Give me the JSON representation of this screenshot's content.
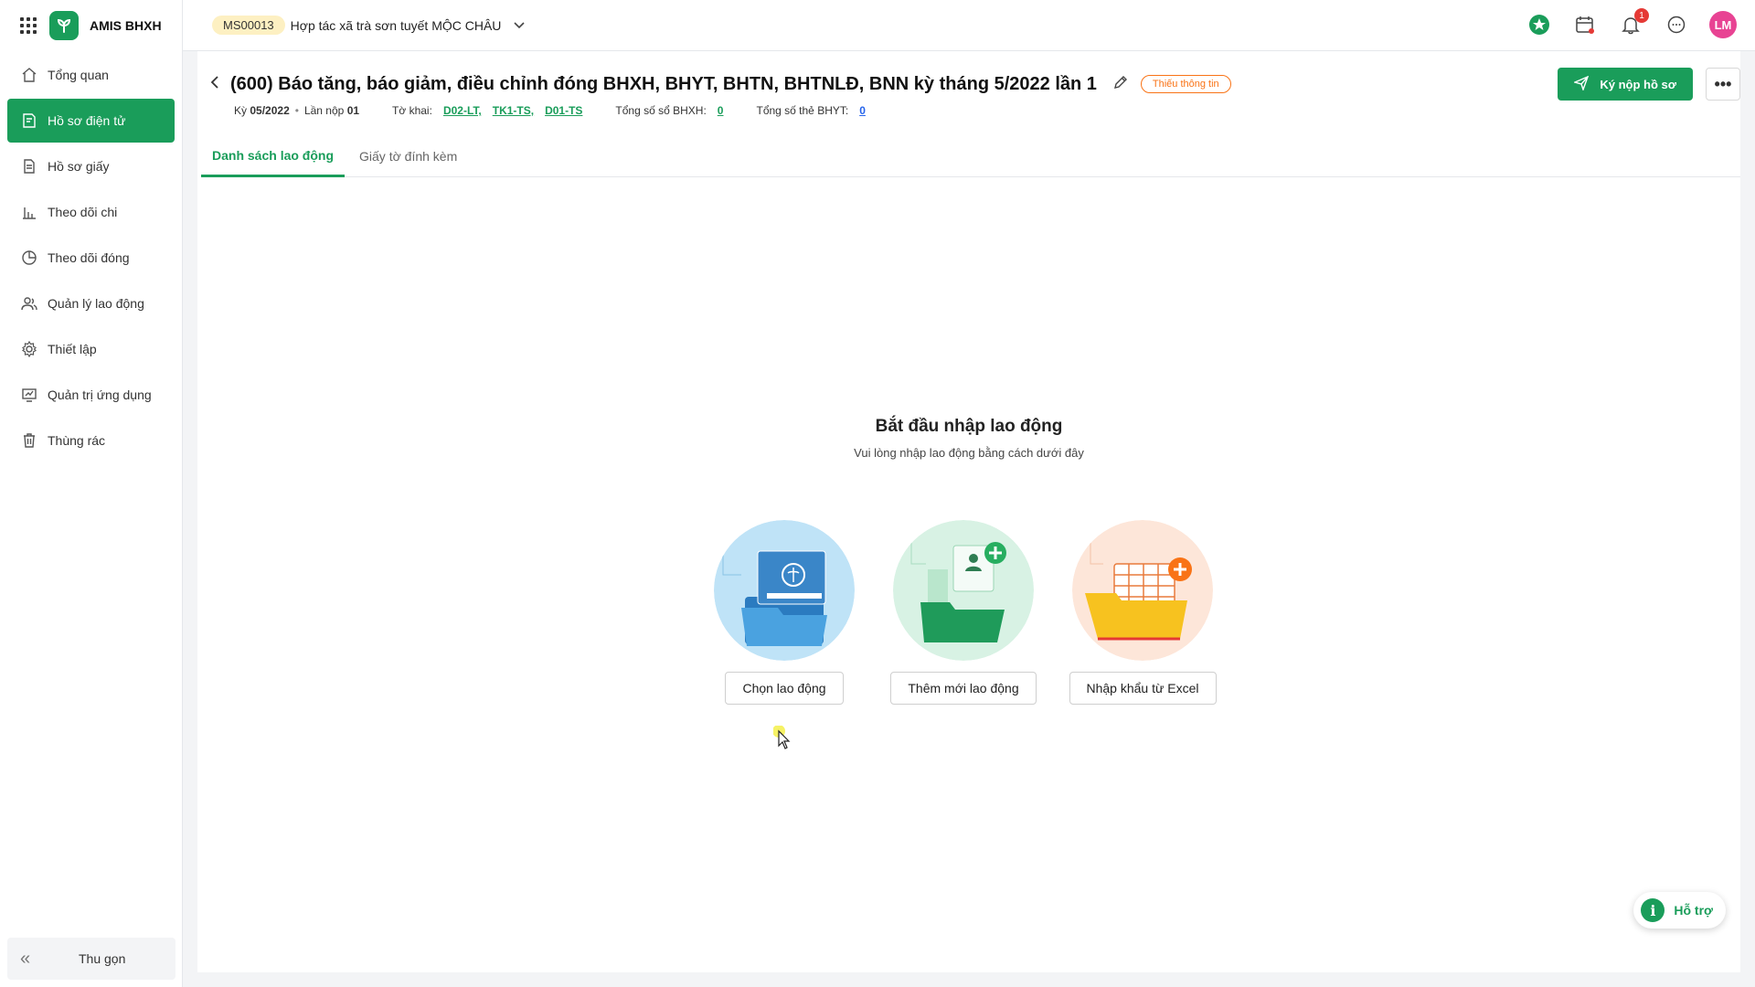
{
  "app": {
    "name": "AMIS BHXH"
  },
  "sidebar": {
    "items": [
      {
        "label": "Tổng quan",
        "icon": "home-icon"
      },
      {
        "label": "Hồ sơ điện tử",
        "icon": "document-edit-icon"
      },
      {
        "label": "Hồ sơ giấy",
        "icon": "paper-document-icon"
      },
      {
        "label": "Theo dõi chi",
        "icon": "bar-chart-icon"
      },
      {
        "label": "Theo dõi đóng",
        "icon": "pie-chart-icon"
      },
      {
        "label": "Quản lý lao động",
        "icon": "users-icon"
      },
      {
        "label": "Thiết lập",
        "icon": "gear-icon"
      },
      {
        "label": "Quản trị ứng dụng",
        "icon": "monitor-chart-icon"
      },
      {
        "label": "Thùng rác",
        "icon": "trash-icon"
      }
    ],
    "active_index": 1,
    "collapse_label": "Thu gọn"
  },
  "topbar": {
    "org_code": "MS00013",
    "org_name": "Hợp tác xã trà sơn tuyết MỘC CHÂU",
    "notification_count": "1",
    "avatar_initials": "LM"
  },
  "header": {
    "title": "(600) Báo tăng, báo giảm, điều chỉnh đóng BHXH, BHYT, BHTN, BHTNLĐ, BNN kỳ tháng 5/2022 lần 1",
    "status": "Thiếu thông tin",
    "submit_label": "Ký nộp hồ sơ",
    "meta": {
      "period_label": "Kỳ",
      "period_value": "05/2022",
      "submission_label": "Lần nộp",
      "submission_value": "01",
      "forms_label": "Tờ khai:",
      "forms": [
        "D02-LT,",
        "TK1-TS,",
        "D01-TS"
      ],
      "bhxh_label": "Tổng số sổ BHXH:",
      "bhxh_value": "0",
      "bhyt_label": "Tổng số thẻ BHYT:",
      "bhyt_value": "0"
    }
  },
  "tabs": [
    {
      "label": "Danh sách lao động"
    },
    {
      "label": "Giấy tờ đính kèm"
    }
  ],
  "empty_state": {
    "title": "Bắt đầu nhập lao động",
    "subtitle": "Vui lòng nhập lao động bằng cách dưới đây",
    "options": [
      {
        "label": "Chọn lao động"
      },
      {
        "label": "Thêm mới lao động"
      },
      {
        "label": "Nhập khẩu từ Excel"
      }
    ]
  },
  "help": {
    "label": "Hỗ trợ"
  },
  "colors": {
    "primary": "#1a9d5a",
    "warning": "#f97316",
    "avatar": "#e84393"
  }
}
